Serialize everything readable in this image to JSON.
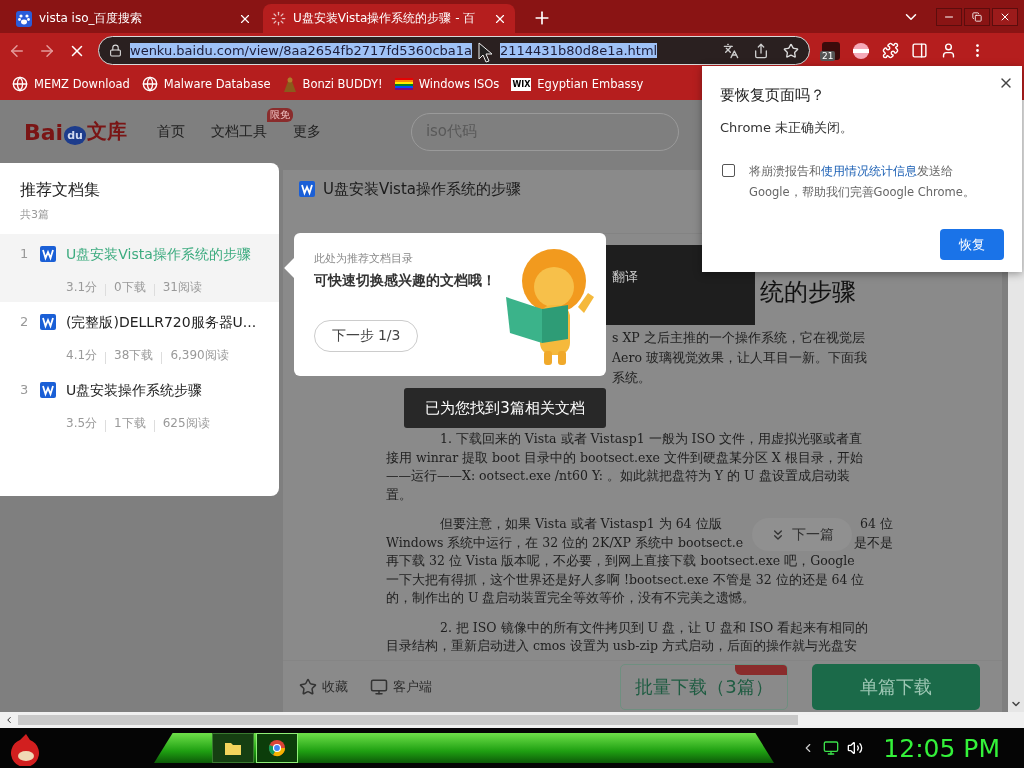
{
  "browser": {
    "tabs": [
      {
        "title": "vista iso_百度搜索",
        "selected": false,
        "loading": false
      },
      {
        "title": "U盘安装Vista操作系统的步骤 - 百",
        "selected": true,
        "loading": true
      }
    ],
    "address": {
      "url_start": "wenku.baidu.com/view/8aa2654fb2717fd5360cba1a",
      "url_end": "2114431b80d8e1a.html",
      "selected": true
    },
    "extension_badge": "21",
    "bookmarks": [
      {
        "label": "MEMZ Download",
        "kind": "globe"
      },
      {
        "label": "Malware Database",
        "kind": "globe"
      },
      {
        "label": "Bonzi BUDDY!",
        "kind": "figure"
      },
      {
        "label": "Windows ISOs",
        "kind": "rainbow"
      },
      {
        "label": "Egyptian Embassy",
        "kind": "text-logo",
        "icon_text": "WIX"
      }
    ]
  },
  "site_header": {
    "logo": [
      "Bai",
      "du",
      "文库"
    ],
    "nav": [
      {
        "label": "首页"
      },
      {
        "label": "文档工具",
        "badge": "限免"
      },
      {
        "label": "更多"
      }
    ],
    "search": {
      "placeholder": "iso代码"
    }
  },
  "collection_panel": {
    "title": "推荐文档集",
    "count": "共3篇",
    "items": [
      {
        "index": "1",
        "title": "U盘安装Vista操作系统的步骤",
        "score": "3.1分",
        "downloads": "0下载",
        "reads": "31阅读",
        "selected": true
      },
      {
        "index": "2",
        "title": "(完整版)DELLR720服务器U...",
        "score": "4.1分",
        "downloads": "38下载",
        "reads": "6,390阅读",
        "selected": false
      },
      {
        "index": "3",
        "title": "U盘安装操作系统步骤",
        "score": "3.5分",
        "downloads": "1下载",
        "reads": "625阅读",
        "selected": false
      }
    ]
  },
  "document": {
    "title": "U盘安装Vista操作系统的步骤",
    "heading_fragment": "统的步骤",
    "intro_fragments": [
      "s XP 之后主推的一个操作系统，它在视觉层",
      "Aero 玻璃视觉效果，让人耳目一新。下面我",
      "系统。"
    ],
    "paragraphs": [
      [
        [
          "1. 下载回来的 Vista 或者 Vistasp1 一般为 ISO 文件，用虚拟光驱或者直"
        ],
        [
          "接用 winrar 提取 boot 目录中的 bootsect.exe 文件到硬盘某分区 X 根目录，开始"
        ],
        [
          "——运行——X: ootsect.exe /nt60 Y: 。如此就把盘符为 Y 的 U 盘设置成启动装"
        ],
        [
          "置。"
        ]
      ],
      [
        [
          "但要注意，如果 Vista 或者 Vistasp1 为 64 位版",
          "64 位"
        ],
        [
          "Windows 系统中运行，在 32 位的 2K/XP 系统中 bootsect.e",
          "是不是"
        ],
        [
          "再下载 32 位 Vista 版本呢，不必要，到网上直接下载 bootsect.exe 吧，Google"
        ],
        [
          "一下大把有得抓，这个世界还是好人多啊 !bootsect.exe 不管是 32 位的还是 64 位"
        ],
        [
          "的，制作出的 U 盘启动装置完全等效等价，没有不完美之遗憾。"
        ]
      ],
      [
        [
          "2. 把 ISO 镜像中的所有文件拷贝到 U 盘，让 U 盘和 ISO 看起来有相同的"
        ],
        [
          "目录结构，重新启动进入 cmos 设置为 usb-zip 方式启动，后面的操作就与光盘安"
        ]
      ]
    ]
  },
  "selection_toolbar": {
    "label": "翻译"
  },
  "guide_tip": {
    "caption": "此处为推荐文档目录",
    "message": "可快速切换感兴趣的文档哦！",
    "button": "下一步 1/3"
  },
  "toast": "已为您找到3篇相关文档",
  "next_button": "下一篇",
  "action_bar": {
    "favorite": "收藏",
    "client": "客户端",
    "batch_download": "批量下载（3篇）",
    "single_download": "单篇下载"
  },
  "restore_dialog": {
    "title": "要恢复页面吗？",
    "message": "Chrome 未正确关闭。",
    "consent": {
      "checked": false,
      "before": "将崩溃报告和",
      "link": "使用情况统计信息",
      "after": "发送给Google，帮助我们完善Google Chrome。"
    },
    "button": "恢复"
  },
  "taskbar": {
    "apps": [
      {
        "kind": "folder",
        "selected": false
      },
      {
        "kind": "browser",
        "selected": true
      }
    ],
    "clock": "12:05 PM"
  }
}
